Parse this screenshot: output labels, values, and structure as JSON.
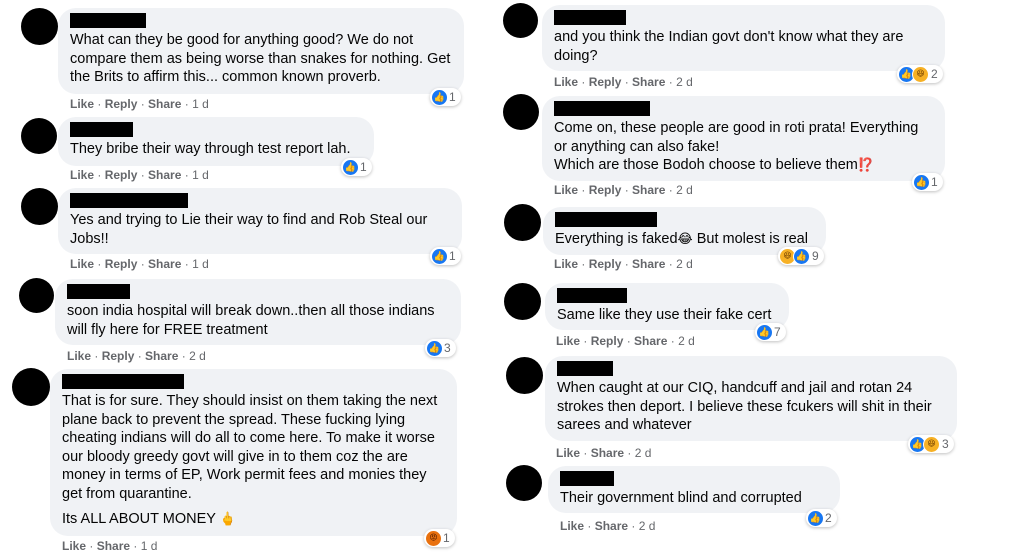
{
  "comments": [
    {
      "text": "What can they be good for anything good? We do not compare them as being worse than snakes for nothing. Get the Brits to affirm this... common known proverb.",
      "actions": [
        "Like",
        "Reply",
        "Share"
      ],
      "time": "1 d",
      "reaction_count": "1"
    },
    {
      "text": "They bribe their way through test report lah.",
      "actions": [
        "Like",
        "Reply",
        "Share"
      ],
      "time": "1 d",
      "reaction_count": "1"
    },
    {
      "text": "Yes and trying to Lie their way to find and Rob Steal our Jobs!!",
      "actions": [
        "Like",
        "Reply",
        "Share"
      ],
      "time": "1 d",
      "reaction_count": "1"
    },
    {
      "text": "soon india hospital will break down..then all those indians will fly here for FREE treatment",
      "actions": [
        "Like",
        "Reply",
        "Share"
      ],
      "time": "2 d",
      "reaction_count": "3"
    },
    {
      "text": "That is for sure. They should insist on them taking the next plane back to prevent the spread. These fucking lying cheating indians will do all to come here. To make it worse our bloody greedy govt will give in to them coz the are money in terms of EP, Work permit fees and monies they get from quarantine.",
      "text2": "Its ALL ABOUT MONEY",
      "emoji": "🖕",
      "actions": [
        "Like",
        "Share"
      ],
      "time": "1 d",
      "reaction_count": "1"
    },
    {
      "text": "and you think the Indian govt don't know what they are doing?",
      "actions": [
        "Like",
        "Reply",
        "Share"
      ],
      "time": "2 d",
      "reaction_count": "2"
    },
    {
      "text": "Come on, these people are good in roti prata! Everything or anything can also fake!",
      "text2": "Which are those Bodoh choose to believe them",
      "emoji": "⁉️",
      "actions": [
        "Like",
        "Reply",
        "Share"
      ],
      "time": "2 d",
      "reaction_count": "1"
    },
    {
      "text": "Everything is faked",
      "emoji": "😂",
      "text_after": " But molest is real",
      "actions": [
        "Like",
        "Reply",
        "Share"
      ],
      "time": "2 d",
      "reaction_count": "9"
    },
    {
      "text": "Same like they use their fake cert",
      "actions": [
        "Like",
        "Reply",
        "Share"
      ],
      "time": "2 d",
      "reaction_count": "7"
    },
    {
      "text": "When caught at our CIQ, handcuff and jail and rotan 24 strokes then deport. I believe these fcukers will shit in their sarees and whatever",
      "actions": [
        "Like",
        "Share"
      ],
      "time": "2 d",
      "reaction_count": "3"
    },
    {
      "text": "Their government blind and corrupted",
      "actions": [
        "Like",
        "Share"
      ],
      "time": "2 d",
      "reaction_count": "2"
    }
  ],
  "icons": {
    "like": "like-reaction-icon",
    "haha": "haha-reaction-icon",
    "angry": "angry-reaction-icon"
  },
  "colors": {
    "bubble": "#f0f2f5",
    "like": "#1877f2",
    "meta_text": "#65676b"
  }
}
